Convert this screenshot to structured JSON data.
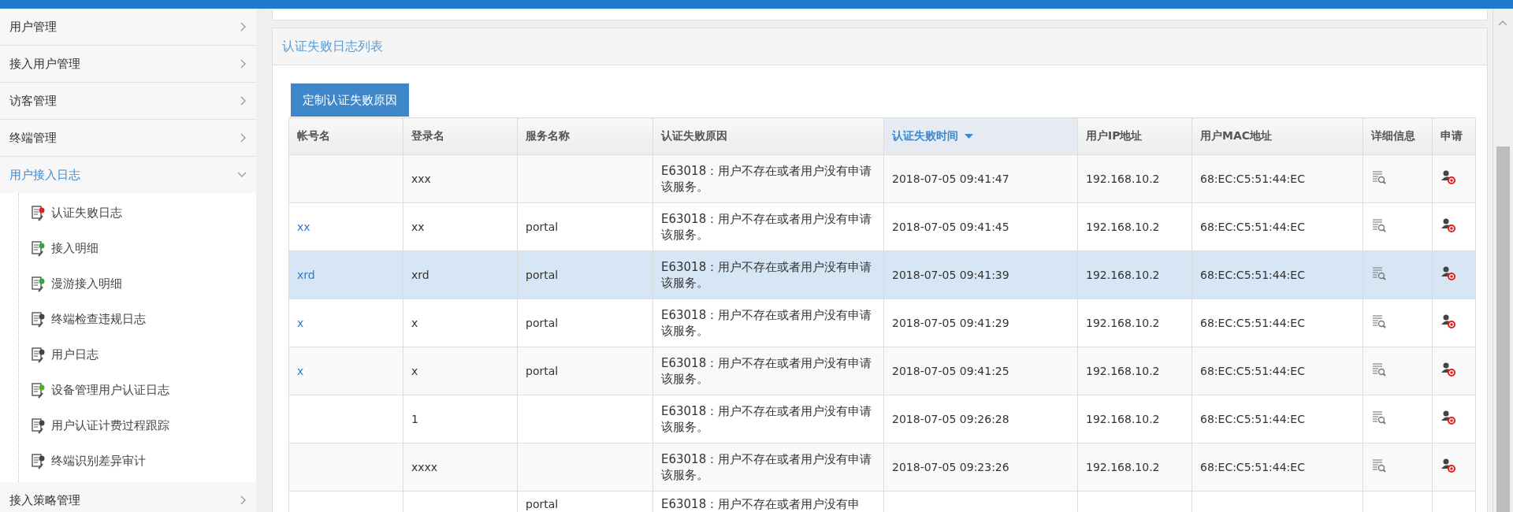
{
  "sidebar": {
    "items": [
      {
        "label": "用户管理",
        "expanded": false,
        "selected": false
      },
      {
        "label": "接入用户管理",
        "expanded": false,
        "selected": false
      },
      {
        "label": "访客管理",
        "expanded": false,
        "selected": false
      },
      {
        "label": "终端管理",
        "expanded": false,
        "selected": false
      },
      {
        "label": "用户接入日志",
        "expanded": true,
        "selected": true,
        "children": [
          {
            "label": "认证失败日志"
          },
          {
            "label": "接入明细"
          },
          {
            "label": "漫游接入明细"
          },
          {
            "label": "终端检查违规日志"
          },
          {
            "label": "用户日志"
          },
          {
            "label": "设备管理用户认证日志"
          },
          {
            "label": "用户认证计费过程跟踪"
          },
          {
            "label": "终端识别差异审计"
          }
        ]
      },
      {
        "label": "接入策略管理",
        "expanded": false,
        "selected": false
      }
    ]
  },
  "panel": {
    "title": "认证失败日志列表",
    "button": "定制认证失败原因"
  },
  "table": {
    "columns": [
      {
        "label": "帐号名",
        "sorted": false
      },
      {
        "label": "登录名",
        "sorted": false
      },
      {
        "label": "服务名称",
        "sorted": false
      },
      {
        "label": "认证失败原因",
        "sorted": false
      },
      {
        "label": "认证失败时间",
        "sorted": true
      },
      {
        "label": "用户IP地址",
        "sorted": false
      },
      {
        "label": "用户MAC地址",
        "sorted": false
      },
      {
        "label": "详细信息",
        "sorted": false
      },
      {
        "label": "申请",
        "sorted": false
      }
    ],
    "rows": [
      {
        "account": "",
        "login": "xxx",
        "service": "",
        "reason": "E63018：用户不存在或者用户没有申请该服务。",
        "time": "2018-07-05 09:41:47",
        "ip": "192.168.10.2",
        "mac": "68:EC:C5:51:44:EC",
        "selected": false
      },
      {
        "account": "xx",
        "login": "xx",
        "service": "portal",
        "reason": "E63018：用户不存在或者用户没有申请该服务。",
        "time": "2018-07-05 09:41:45",
        "ip": "192.168.10.2",
        "mac": "68:EC:C5:51:44:EC",
        "selected": false
      },
      {
        "account": "xrd",
        "login": "xrd",
        "service": "portal",
        "reason": "E63018：用户不存在或者用户没有申请该服务。",
        "time": "2018-07-05 09:41:39",
        "ip": "192.168.10.2",
        "mac": "68:EC:C5:51:44:EC",
        "selected": true
      },
      {
        "account": "x",
        "login": "x",
        "service": "portal",
        "reason": "E63018：用户不存在或者用户没有申请该服务。",
        "time": "2018-07-05 09:41:29",
        "ip": "192.168.10.2",
        "mac": "68:EC:C5:51:44:EC",
        "selected": false
      },
      {
        "account": "x",
        "login": "x",
        "service": "portal",
        "reason": "E63018：用户不存在或者用户没有申请该服务。",
        "time": "2018-07-05 09:41:25",
        "ip": "192.168.10.2",
        "mac": "68:EC:C5:51:44:EC",
        "selected": false
      },
      {
        "account": "",
        "login": "1",
        "service": "",
        "reason": "E63018：用户不存在或者用户没有申请该服务。",
        "time": "2018-07-05 09:26:28",
        "ip": "192.168.10.2",
        "mac": "68:EC:C5:51:44:EC",
        "selected": false
      },
      {
        "account": "",
        "login": "xxxx",
        "service": "",
        "reason": "E63018：用户不存在或者用户没有申请该服务。",
        "time": "2018-07-05 09:23:26",
        "ip": "192.168.10.2",
        "mac": "68:EC:C5:51:44:EC",
        "selected": false
      },
      {
        "account": "",
        "login": "",
        "service": "portal",
        "reason": "E63018：用户不存在或者用户没有申",
        "time": "",
        "ip": "",
        "mac": "",
        "selected": false
      }
    ]
  }
}
